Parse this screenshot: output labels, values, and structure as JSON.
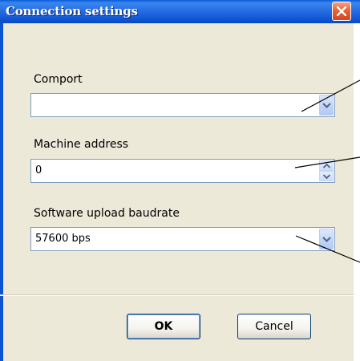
{
  "window": {
    "title": "Connection settings"
  },
  "fields": {
    "comport": {
      "label": "Comport",
      "value": ""
    },
    "machine_address": {
      "label": "Machine address",
      "value": "0"
    },
    "baudrate": {
      "label": "Software upload baudrate",
      "value": "57600 bps"
    }
  },
  "buttons": {
    "ok": "OK",
    "cancel": "Cancel"
  },
  "colors": {
    "titlebar": "#0d54d1",
    "dialog_background": "#ece9d8",
    "field_border": "#7f9db9",
    "close_button": "#e5633a"
  },
  "icons": [
    "close-icon",
    "chevron-down-icon",
    "spin-up-icon",
    "spin-down-icon"
  ]
}
